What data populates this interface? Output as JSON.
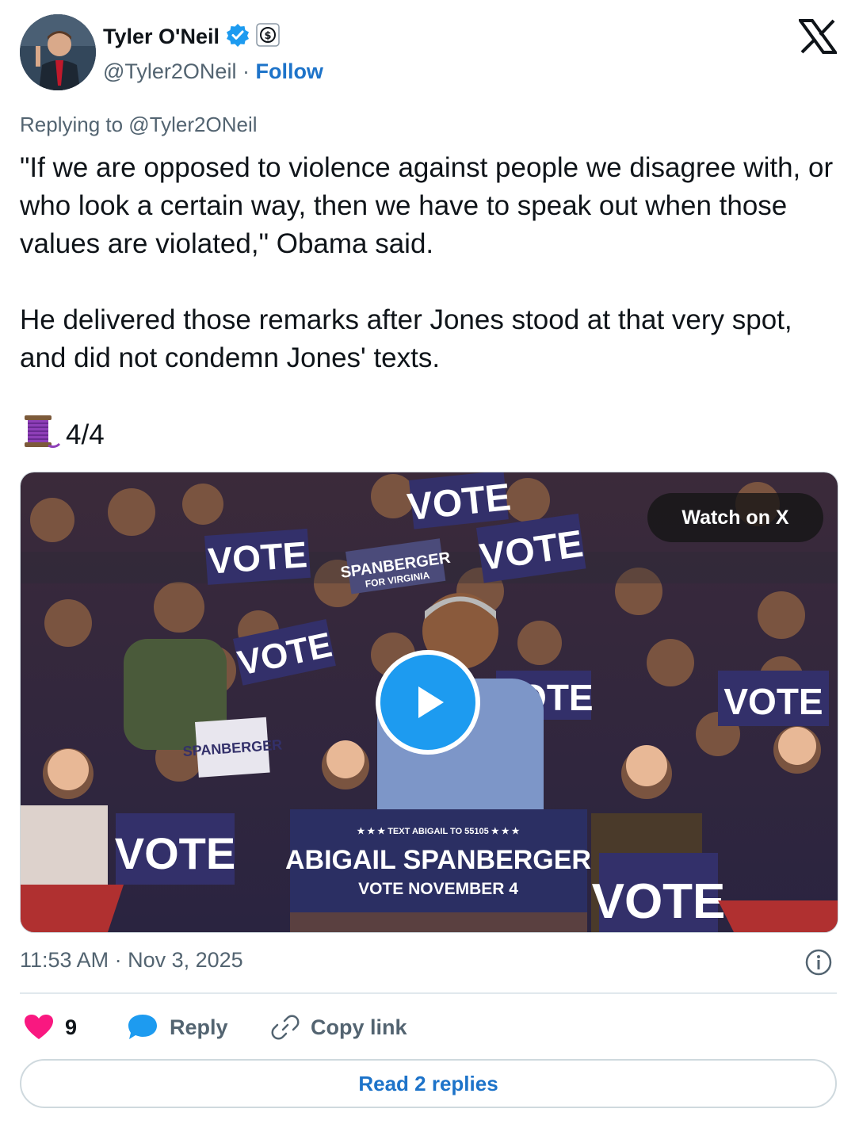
{
  "author": {
    "display_name": "Tyler O'Neil",
    "handle": "@Tyler2ONeil",
    "separator": " · ",
    "follow_label": "Follow"
  },
  "tweet": {
    "replying_to": "Replying to @Tyler2ONeil",
    "text": "\"If we are opposed to violence against people we disagree with, or who look a certain way, then we have to speak out when those values are violated,\" Obama said.\n\nHe delivered those remarks after Jones stood at that very spot, and did not condemn Jones' texts.",
    "thread_counter": "4/4",
    "thread_icon": "thread-spool-icon"
  },
  "media": {
    "watch_label": "Watch on X",
    "podium_top": "★ ★ ★  TEXT ABIGAIL TO 55105  ★ ★ ★",
    "podium_name": "ABIGAIL SPANBERGER",
    "podium_date": "VOTE NOVEMBER 4",
    "sign_vote": "VOTE",
    "sign_spanberger": "SPANBERGER",
    "sign_virginia": "FOR VIRGINIA"
  },
  "meta": {
    "timestamp": "11:53 AM · Nov 3, 2025"
  },
  "actions": {
    "like_count": "9",
    "reply_label": "Reply",
    "copy_label": "Copy link",
    "read_replies_label": "Read 2 replies"
  },
  "colors": {
    "link_blue": "#1d73c9",
    "play_blue": "#1d9bf0",
    "like_red": "#f91880",
    "muted_gray": "#536471",
    "verified_blue": "#1d9bf0"
  }
}
